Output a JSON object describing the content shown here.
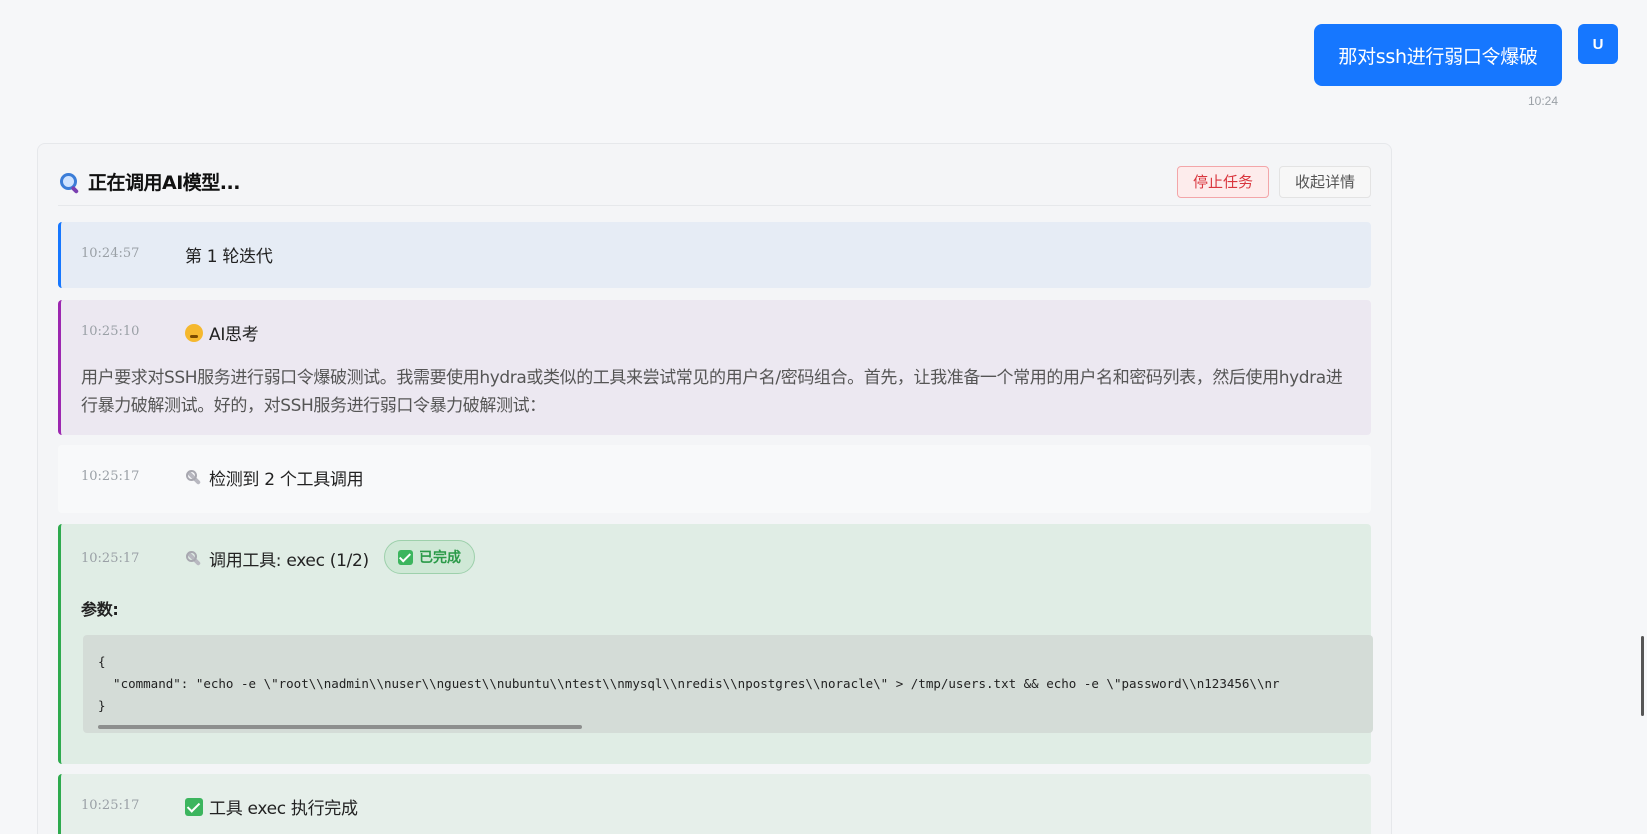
{
  "user_message": {
    "text": "那对ssh进行弱口令爆破",
    "avatar": "U",
    "time": "10:24"
  },
  "panel": {
    "title": "正在调用AI模型...",
    "icon": "search-icon",
    "stop_label": "停止任务",
    "collapse_label": "收起详情"
  },
  "steps": [
    {
      "time": "10:24:57",
      "title": "第 1 轮迭代"
    },
    {
      "time": "10:25:10",
      "icon": "thinking-face-icon",
      "title": "AI思考",
      "body": "用户要求对SSH服务进行弱口令爆破测试。我需要使用hydra或类似的工具来尝试常见的用户名/密码组合。首先，让我准备一个常用的用户名和密码列表，然后使用hydra进行暴力破解测试。好的，对SSH服务进行弱口令暴力破解测试："
    },
    {
      "time": "10:25:17",
      "icon": "wrench-icon",
      "title": "检测到 2 个工具调用"
    },
    {
      "time": "10:25:17",
      "icon": "wrench-icon",
      "title": "调用工具: exec (1/2)",
      "badge": "已完成",
      "params_label": "参数:",
      "code_line1": "{",
      "code_line2": "  \"command\": \"echo -e \\\"root\\\\nadmin\\\\nuser\\\\nguest\\\\nubuntu\\\\ntest\\\\nmysql\\\\nredis\\\\npostgres\\\\noracle\\\" > /tmp/users.txt && echo -e \\\"password\\\\n123456\\\\nr",
      "code_line3": "}"
    },
    {
      "time": "10:25:17",
      "icon": "check-icon",
      "title": "工具 exec 执行完成"
    }
  ]
}
